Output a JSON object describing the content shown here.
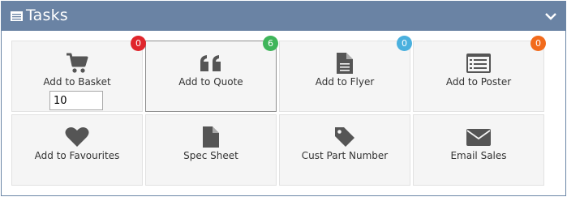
{
  "panel": {
    "title": "Tasks",
    "title_icon": "list-icon",
    "collapse_icon": "chevron-down-icon"
  },
  "tiles": [
    {
      "label": "Add to Basket",
      "icon": "cart-icon",
      "badge": "0",
      "badge_color": "#e0262c",
      "quantity": "10"
    },
    {
      "label": "Add to Quote",
      "icon": "quote-icon",
      "badge": "6",
      "badge_color": "#3fb55a"
    },
    {
      "label": "Add to Flyer",
      "icon": "document-icon",
      "badge": "0",
      "badge_color": "#4ab0de"
    },
    {
      "label": "Add to Poster",
      "icon": "poster-list-icon",
      "badge": "0",
      "badge_color": "#f26b1c"
    },
    {
      "label": "Add to Favourites",
      "icon": "heart-icon"
    },
    {
      "label": "Spec Sheet",
      "icon": "file-icon"
    },
    {
      "label": "Cust Part Number",
      "icon": "tag-icon"
    },
    {
      "label": "Email Sales",
      "icon": "envelope-icon"
    }
  ],
  "colors": {
    "header": "#6a83a4",
    "icon": "#555555"
  }
}
